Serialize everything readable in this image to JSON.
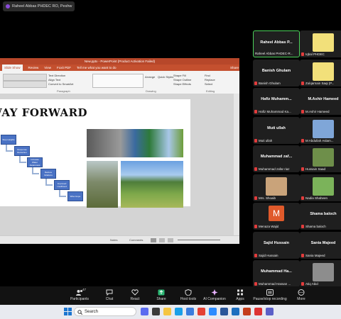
{
  "zoom": {
    "window_title": "Raheel Abbas PHDEC RO, Peshw",
    "toolbar": [
      {
        "label": "Participants",
        "badge": "47",
        "icon": "participants-icon"
      },
      {
        "label": "Chat",
        "icon": "chat-icon"
      },
      {
        "label": "React",
        "icon": "react-icon"
      },
      {
        "label": "Share",
        "icon": "share-icon"
      },
      {
        "label": "Host tools",
        "icon": "shield-icon"
      },
      {
        "label": "AI Companion",
        "icon": "ai-icon"
      },
      {
        "label": "Apps",
        "icon": "apps-icon"
      },
      {
        "label": "Pause/stop recording",
        "icon": "pause-icon"
      },
      {
        "label": "More",
        "icon": "more-icon"
      }
    ]
  },
  "powerpoint": {
    "title": "New.pptx - PowerPoint (Product Activation Failed)",
    "tabs": [
      "Slide Show",
      "Review",
      "View",
      "Foxit PDF",
      "Tell me what you want to do"
    ],
    "share_button": "Share",
    "ribbon_groups": [
      "Paragraph",
      "Drawing",
      "Editing"
    ],
    "ribbon_items": [
      "Text Direction",
      "Align Text",
      "Convert to SmartArt",
      "Shape Fill",
      "Shape Outline",
      "Shape Effects",
      "Arrange",
      "Quick Styles",
      "Find",
      "Replace",
      "Select"
    ],
    "slide": {
      "title": "WAY FORWARD",
      "steps": [
        "Step Heights",
        "Response Reduction",
        "Increase Water Awareness",
        "Reduce Gilations",
        "Improved Livelihood",
        "Wise Hope"
      ]
    },
    "status": {
      "notes": "Notes",
      "comments": "Comments"
    }
  },
  "participants": [
    {
      "name": "Raheel Abbas P...",
      "label": "Raheel Abbas PHDEC-R...",
      "muted": false,
      "active": true,
      "thumb": false
    },
    {
      "name": "",
      "label": "Iqbal PHDEC",
      "muted": true,
      "active": false,
      "thumb": true,
      "thumb_color": "#f2e07a"
    },
    {
      "name": "Banish Ghulam",
      "label": "Banish Ghulam",
      "muted": true,
      "active": false,
      "thumb": false
    },
    {
      "name": "",
      "label": "Zulqarnain Saqi (P...",
      "muted": true,
      "active": false,
      "thumb": true,
      "thumb_color": "#f2e07a"
    },
    {
      "name": "Hafiz Muhamm...",
      "label": "Hafiz Muhammad Ka...",
      "muted": true,
      "active": false,
      "thumb": false
    },
    {
      "name": "M.Ashir Hameed",
      "label": "M.Ashir Hameed",
      "muted": true,
      "active": false,
      "thumb": false
    },
    {
      "name": "Muti ullah",
      "label": "Muti ullah",
      "muted": true,
      "active": false,
      "thumb": false
    },
    {
      "name": "",
      "label": "M Abdullah Aslam...",
      "muted": true,
      "active": false,
      "thumb": true,
      "thumb_color": "#7fa6d8"
    },
    {
      "name": "Muhammad zaf...",
      "label": "Muhammad zafar riaz",
      "muted": true,
      "active": false,
      "thumb": false
    },
    {
      "name": "",
      "label": "Hussain Saad",
      "muted": true,
      "active": false,
      "thumb": true,
      "thumb_color": "#6e8f4a"
    },
    {
      "name": "",
      "label": "Mrs. Shoaib",
      "muted": true,
      "active": false,
      "thumb": true,
      "thumb_color": "#c9a37a"
    },
    {
      "name": "",
      "label": "Nadia Shaheen",
      "muted": true,
      "active": false,
      "thumb": true,
      "thumb_color": "#7bb35a"
    },
    {
      "name": "",
      "label": "Menaza Wajid",
      "muted": true,
      "active": false,
      "thumb": true,
      "thumb_color": "#e05a2b",
      "initial": "M"
    },
    {
      "name": "Shama baloch",
      "label": "Shama baloch",
      "muted": true,
      "active": false,
      "thumb": false
    },
    {
      "name": "Sajid Hussain",
      "label": "Sajid Hussain",
      "muted": true,
      "active": false,
      "thumb": false
    },
    {
      "name": "Sania Majeed",
      "label": "Sania Majeed",
      "muted": true,
      "active": false,
      "thumb": false
    },
    {
      "name": "Muhammad Ha...",
      "label": "Muhammad Hassan ...",
      "muted": true,
      "active": false,
      "thumb": false
    },
    {
      "name": "",
      "label": "Atiq Abid",
      "muted": true,
      "active": false,
      "thumb": true,
      "thumb_color": "#8d8d8d"
    }
  ],
  "taskbar": {
    "search_placeholder": "Search"
  }
}
